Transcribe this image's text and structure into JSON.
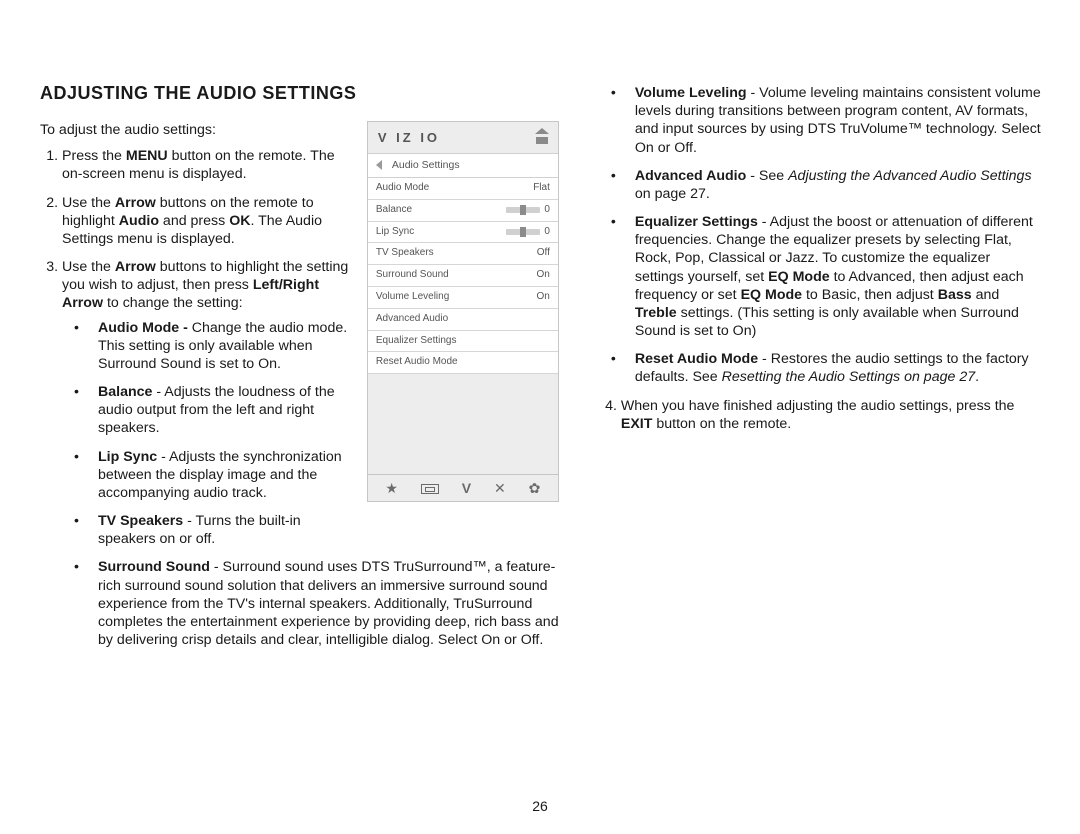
{
  "page_number": "26",
  "heading": "ADJUSTING THE AUDIO SETTINGS",
  "intro": "To adjust the audio settings:",
  "step1_a": "Press the ",
  "step1_menu": "MENU",
  "step1_b": " button on the remote. The on-screen menu is displayed.",
  "step2_a": "Use the ",
  "step2_arrow": "Arrow",
  "step2_b": " buttons on the remote to highlight ",
  "step2_audio": "Audio",
  "step2_c": " and press ",
  "step2_ok": "OK",
  "step2_d": ". The Audio Settings menu is displayed.",
  "step3_a": "Use the ",
  "step3_arrow": "Arrow",
  "step3_b": " buttons to highlight the setting you wish to adjust, then press ",
  "step3_lr": "Left/Right Arrow",
  "step3_c": " to change the setting:",
  "audio_mode_t": "Audio Mode - ",
  "audio_mode_d": "Change the audio mode. This setting is only available when Surround Sound is set to On.",
  "balance_t": "Balance",
  "balance_d": " - Adjusts the loudness of the audio output from the left and right speakers.",
  "lipsync_t": "Lip Sync",
  "lipsync_d": " - Adjusts the synchronization between the display image and the accompanying audio track.",
  "tvspeak_t": "TV Speakers",
  "tvspeak_d": " - Turns the built-in speakers on or off.",
  "surround_t": "Surround Sound",
  "surround_d": " - Surround sound uses DTS TruSurround™, a feature-rich surround sound solution that delivers an immersive surround sound experience from the TV's internal speakers. Additionally, TruSurround completes the entertainment experience by providing deep, rich bass and by delivering crisp details and clear, intelligible dialog. Select On or Off.",
  "vollevel_t": "Volume Leveling",
  "vollevel_d": " - Volume leveling maintains consistent volume levels during transitions between program content, AV formats, and input sources by using DTS TruVolume™ technology. Select On or Off.",
  "advaudio_t": "Advanced Audio",
  "advaudio_a": " - See ",
  "advaudio_i": "Adjusting the Advanced Audio Settings",
  "advaudio_b": " on page 27.",
  "eq_t": "Equalizer Settings",
  "eq_a": " - Adjust the boost or attenuation of different frequencies. Change the equalizer presets by selecting Flat, Rock, Pop, Classical or Jazz. To customize the equalizer settings yourself, set ",
  "eq_mode": "EQ Mode",
  "eq_b": " to Advanced, then adjust each frequency or set ",
  "eq_c": " to Basic, then adjust ",
  "eq_bass": "Bass",
  "eq_and": " and ",
  "eq_treble": "Treble",
  "eq_d": " settings. (This setting is only available when Surround Sound is set to On)",
  "reset_t": "Reset Audio Mode",
  "reset_a": " - Restores the audio settings to the factory defaults. See ",
  "reset_i": "Resetting the Audio Settings on page 27",
  "reset_b": ".",
  "step4_a": "When you have finished adjusting the audio settings, press the ",
  "step4_exit": "EXIT",
  "step4_b": " button on the remote.",
  "osd": {
    "logo": "V IZ IO",
    "title": "Audio Settings",
    "rows": [
      {
        "label": "Audio Mode",
        "value": "Flat"
      },
      {
        "label": "Balance",
        "value": "0",
        "slider": true
      },
      {
        "label": "Lip Sync",
        "value": "0",
        "slider": true
      },
      {
        "label": "TV Speakers",
        "value": "Off"
      },
      {
        "label": "Surround Sound",
        "value": "On"
      },
      {
        "label": "Volume Leveling",
        "value": "On"
      },
      {
        "label": "Advanced Audio",
        "value": ""
      },
      {
        "label": "Equalizer Settings",
        "value": ""
      },
      {
        "label": "Reset Audio Mode",
        "value": ""
      }
    ],
    "foot_star": "★",
    "foot_v": "V",
    "foot_x": "✕",
    "foot_gear": "✿"
  }
}
